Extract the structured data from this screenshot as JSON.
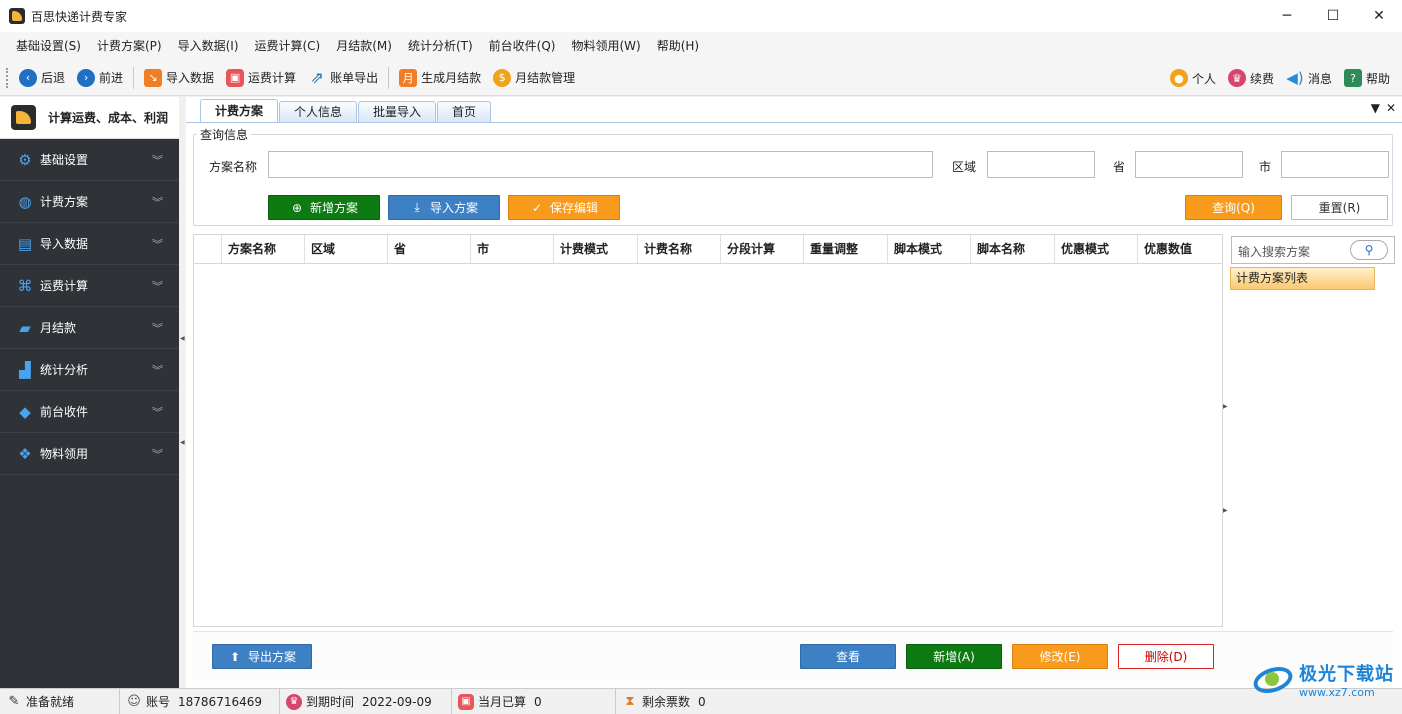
{
  "window": {
    "title": "百思快递计费专家",
    "controls": {
      "minimize": "─",
      "maximize": "☐",
      "close": "✕"
    }
  },
  "menu": [
    "基础设置(S)",
    "计费方案(P)",
    "导入数据(I)",
    "运费计算(C)",
    "月结款(M)",
    "统计分析(T)",
    "前台收件(Q)",
    "物料领用(W)",
    "帮助(H)"
  ],
  "toolbar": {
    "back": "后退",
    "forward": "前进",
    "import_data": "导入数据",
    "freight_calc": "运费计算",
    "bill_export": "账单导出",
    "gen_monthly": "生成月结款",
    "monthly_manage": "月结款管理",
    "personal": "个人",
    "renew": "续费",
    "message": "消息",
    "help": "帮助",
    "monthly_icon_char": "月"
  },
  "sidebar": {
    "header": "计算运费、成本、利润",
    "items": [
      {
        "label": "基础设置",
        "icon": "gear-icon"
      },
      {
        "label": "计费方案",
        "icon": "globe-icon"
      },
      {
        "label": "导入数据",
        "icon": "excel-icon"
      },
      {
        "label": "运费计算",
        "icon": "calculator-icon"
      },
      {
        "label": "月结款",
        "icon": "wallet-icon"
      },
      {
        "label": "统计分析",
        "icon": "chart-icon"
      },
      {
        "label": "前台收件",
        "icon": "box-icon"
      },
      {
        "label": "物料领用",
        "icon": "cubes-icon"
      }
    ]
  },
  "tabs": [
    "计费方案",
    "个人信息",
    "批量导入",
    "首页"
  ],
  "tab_controls": {
    "menu": "▼",
    "close": "✕"
  },
  "query": {
    "legend": "查询信息",
    "plan_name_label": "方案名称",
    "region_label": "区域",
    "province_label": "省",
    "city_label": "市",
    "add_plan": "新增方案",
    "import_plan": "导入方案",
    "save_edit": "保存编辑",
    "search": "查询(Q)",
    "reset": "重置(R)"
  },
  "grid": {
    "columns": [
      "方案名称",
      "区域",
      "省",
      "市",
      "计费模式",
      "计费名称",
      "分段计算",
      "重量调整",
      "脚本模式",
      "脚本名称",
      "优惠模式",
      "优惠数值"
    ],
    "rows": []
  },
  "right_panel": {
    "search_placeholder": "输入搜索方案",
    "list_label": "计费方案列表"
  },
  "bottom": {
    "export_plan": "导出方案",
    "view": "查看",
    "add": "新增(A)",
    "modify": "修改(E)",
    "delete": "删除(D)"
  },
  "status": {
    "ready": "准备就绪",
    "account_label": "账号",
    "account_value": "18786716469",
    "expire_label": "到期时间",
    "expire_value": "2022-09-09",
    "month_calc_label": "当月已算",
    "month_calc_value": "0",
    "remain_label": "剩余票数",
    "remain_value": "0"
  },
  "watermark": {
    "line1": "极光下载站",
    "line2": "www.xz7.com"
  },
  "colors": {
    "sidebar_bg": "#2f3338",
    "btn_green": "#0e7a12",
    "btn_blue": "#3d80c4",
    "btn_orange": "#f89a1c",
    "accent_blue": "#1f6fc5"
  }
}
